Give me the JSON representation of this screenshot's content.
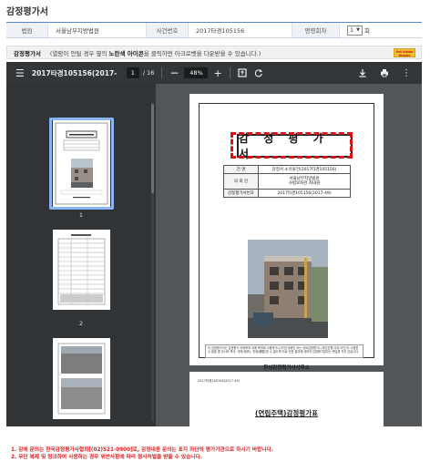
{
  "page": {
    "title": "감정평가서"
  },
  "info": {
    "court_label": "법원",
    "court_value": "서울남부지방법원",
    "case_label": "사건번호",
    "case_value": "2017타경105156",
    "sale_label": "명령회차",
    "sale_value": "1",
    "sale_unit": "회"
  },
  "notice": {
    "title": "감정평가서",
    "text_prefix": "(열람이 안될 경우 옆의 ",
    "text_bold": "노란색 아이콘",
    "text_suffix": "을 클릭하면 아크로벳을 다운받을 수 있습니다.)",
    "badge_line1": "Get Adobe",
    "badge_line2": "Reader"
  },
  "viewer": {
    "doc_title": "2017타경105156(2017-...",
    "current_page": "1",
    "total_pages": "/ 16",
    "zoom": "48%",
    "thumbnails": [
      {
        "num": "1"
      },
      {
        "num": "2"
      },
      {
        "num": "3"
      }
    ],
    "page1": {
      "heading": "감 정 평 가 서",
      "rows": [
        {
          "k": "건    명",
          "v": "감정서 소유물건(2017타경105156)"
        },
        {
          "k": "의 뢰 인",
          "v": "서울남부지방법원\n사법보좌관 최내원"
        },
        {
          "k": "감정평가서번호",
          "v": "2017타경105156(2017-49)"
        }
      ],
      "note": "이 감정평가서는 감정평가 의뢰목적 외에 목적에 사용하거나 타인(의뢰인 또는 담보감정평가시 확인은행 이외 타인)이 사용할 수 없을 뿐 아니라 복사, 개작(改作), 전재(轉載)할 수 없으며 이로 인한 결과에 대하여 감정평가업자는 책임을 지지 않습니다.",
      "office": "한성감정평가사사무소",
      "office_small": "한성감정평가사사무소"
    },
    "page2": {
      "ref": "2017타경105156(2017-49)",
      "title": "(연립주택)감정평가표"
    }
  },
  "footer": {
    "line1": "1. 감에 문의는 한국감정평가사협회[(02)521-0900]로, 감정내용 문의는 표지 하단의 평가기관으로 하시기 바랍니다.",
    "line2": "2. 무단 복제 및 링크하여 사용하는 경우 위반사항에 따라 형사처벌을 받을 수 있습니다."
  },
  "colors": {
    "accent": "#5b86c6",
    "viewer_bg": "#525659",
    "toolbar_bg": "#323639",
    "highlight": "#d6151a",
    "footer_text": "#e01e1e"
  }
}
